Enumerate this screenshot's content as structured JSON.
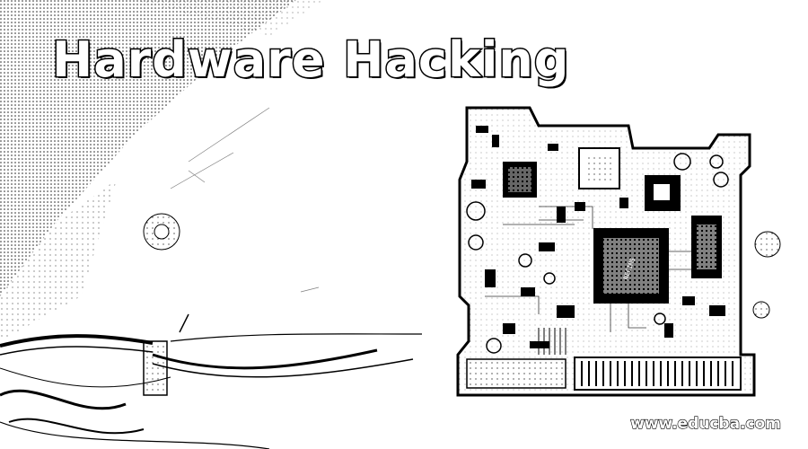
{
  "image": {
    "title": "Hardware Hacking",
    "watermark": "www.educba.com",
    "palette": {
      "background": "#ffffff",
      "ink": "#000000",
      "title_fill": "#ffffff"
    }
  }
}
